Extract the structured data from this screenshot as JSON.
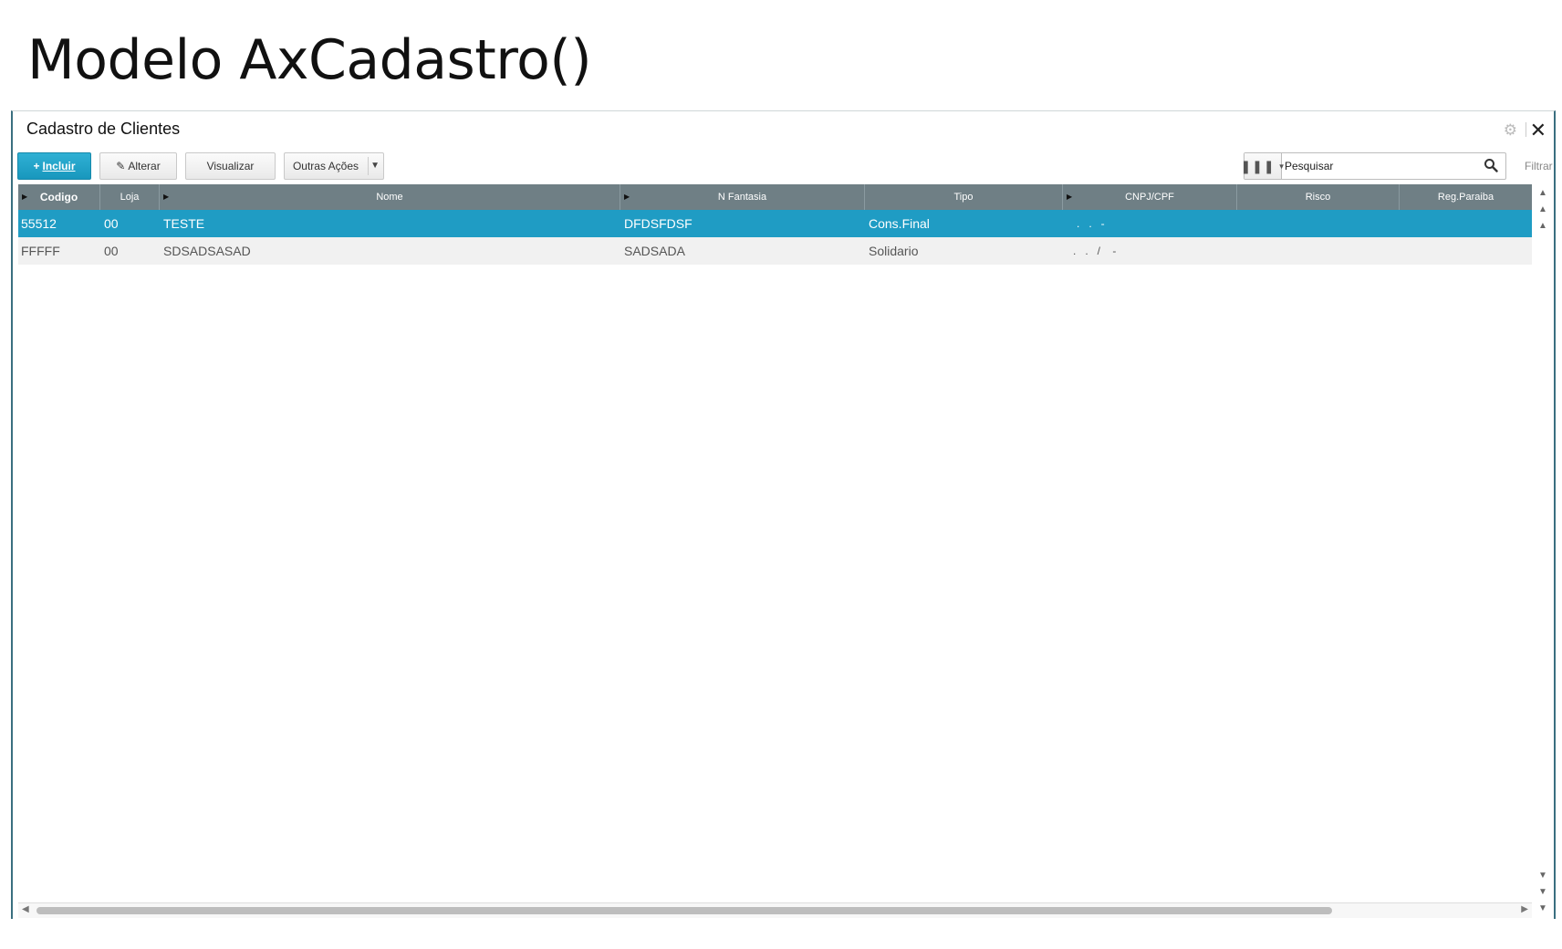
{
  "slide": {
    "title": "Modelo AxCadastro()"
  },
  "window": {
    "title": "Cadastro de Clientes"
  },
  "toolbar": {
    "incluir": "Incluir",
    "alterar": "Alterar",
    "visualizar": "Visualizar",
    "outras_acoes": "Outras Ações"
  },
  "search": {
    "placeholder": "Pesquisar",
    "value": "Pesquisar",
    "filtrar": "Filtrar"
  },
  "table": {
    "columns": [
      "Codigo",
      "Loja",
      "Nome",
      "N Fantasia",
      "Tipo",
      "CNPJ/CPF",
      "Risco",
      "Reg.Paraiba"
    ],
    "rows": [
      {
        "codigo": "55512",
        "loja": "00",
        "nome": "TESTE",
        "fantasia": "DFDSFDSF",
        "tipo": "Cons.Final",
        "cnpj": ".   .   -",
        "risco": "",
        "reg": ""
      },
      {
        "codigo": "FFFFF",
        "loja": "00",
        "nome": "SDSADSASAD",
        "fantasia": "SADSADA",
        "tipo": "Solidario",
        "cnpj": ".   .   /    -",
        "risco": "",
        "reg": ""
      }
    ],
    "selected_row": 0
  },
  "colors": {
    "accent": "#1f9cc4",
    "header_bg": "#6f7f85",
    "window_border": "#3a6f80"
  }
}
